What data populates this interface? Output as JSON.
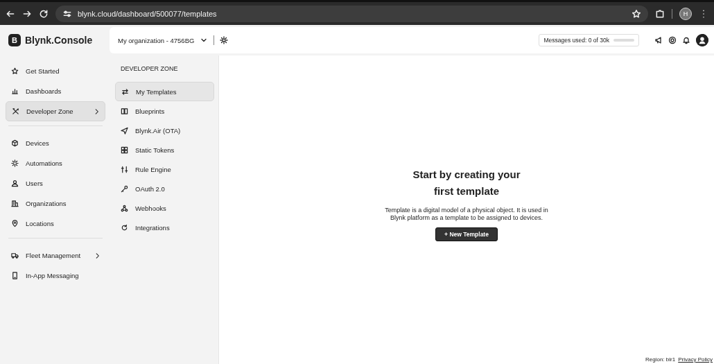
{
  "browser": {
    "url": "blynk.cloud/dashboard/500077/templates",
    "profile_initial": "H"
  },
  "app": {
    "logo_letter": "B",
    "title": "Blynk.Console"
  },
  "header": {
    "organization": "My organization - 4756BG",
    "messages": "Messages used: 0 of 30k",
    "level": 0.0
  },
  "sidebar": {
    "groups": [
      [
        {
          "label": "Get Started",
          "selected": false,
          "has_arrow": false
        },
        {
          "label": "Dashboards",
          "selected": false,
          "has_arrow": false
        },
        {
          "label": "Developer Zone",
          "selected": true,
          "has_arrow": true
        }
      ],
      [
        {
          "label": "Devices",
          "selected": false,
          "has_arrow": false
        },
        {
          "label": "Automations",
          "selected": false,
          "has_arrow": false
        },
        {
          "label": "Users",
          "selected": false,
          "has_arrow": false
        },
        {
          "label": "Organizations",
          "selected": false,
          "has_arrow": false
        },
        {
          "label": "Locations",
          "selected": false,
          "has_arrow": false
        }
      ],
      [
        {
          "label": "Fleet Management",
          "selected": false,
          "has_arrow": true
        },
        {
          "label": "In-App Messaging",
          "selected": false,
          "has_arrow": false
        }
      ]
    ]
  },
  "developer_zone": {
    "heading": "DEVELOPER ZONE",
    "items": [
      {
        "label": "My Templates",
        "selected": true
      },
      {
        "label": "Blueprints",
        "selected": false
      },
      {
        "label": "Blynk.Air (OTA)",
        "selected": false
      },
      {
        "label": "Static Tokens",
        "selected": false
      },
      {
        "label": "Rule Engine",
        "selected": false
      },
      {
        "label": "OAuth 2.0",
        "selected": false
      },
      {
        "label": "Webhooks",
        "selected": false
      },
      {
        "label": "Integrations",
        "selected": false
      }
    ]
  },
  "empty_state": {
    "title": "Start by creating your first template",
    "description": "Template is a digital model of a physical object. It is used in Blynk platform as a template to be assigned to devices.",
    "button": "+ New Template"
  },
  "footer": {
    "region": "Region: blr1",
    "privacy_link": "Privacy Policy"
  }
}
